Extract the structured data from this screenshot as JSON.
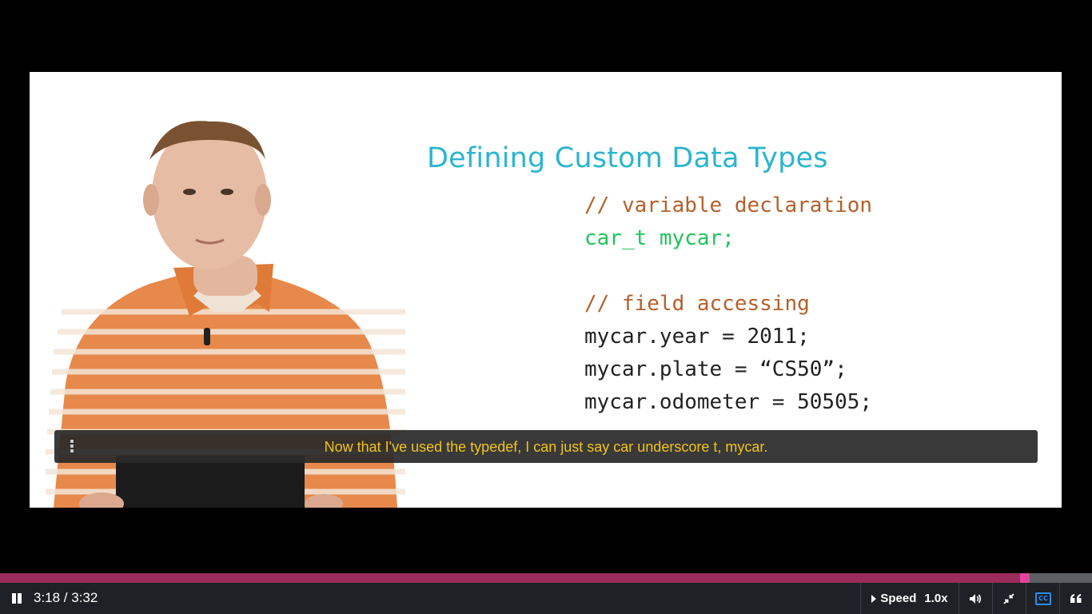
{
  "slide": {
    "title": "Defining Custom Data Types",
    "lines": [
      "// variable declaration",
      "car_t mycar;",
      "// field accessing",
      "mycar.year = 2011;",
      "mycar.plate = “CS50”;",
      "mycar.odometer = 50505;"
    ]
  },
  "caption": {
    "text": "Now that I've used the typedef, I can just say car underscore t, mycar."
  },
  "player": {
    "current_time": "3:18",
    "duration": "3:32",
    "time_display": "3:18 / 3:32",
    "progress_fraction": 0.9387,
    "speed_label": "Speed",
    "speed_value": "1.0x",
    "icons": {
      "play_pause": "pause-icon",
      "volume": "volume-icon",
      "fullscreen": "exit-fullscreen-icon",
      "captions": "closed-captions-icon",
      "transcript": "quote-icon",
      "caption_menu": "vertical-ellipsis-icon"
    }
  },
  "colors": {
    "title": "#2bb5cf",
    "comment": "#b4602b",
    "declaration": "#21c45b",
    "caption_text": "#f2c418",
    "progress_fill": "#9b2c5c",
    "progress_knob": "#e0479a",
    "cc_active": "#2a8cf2"
  }
}
